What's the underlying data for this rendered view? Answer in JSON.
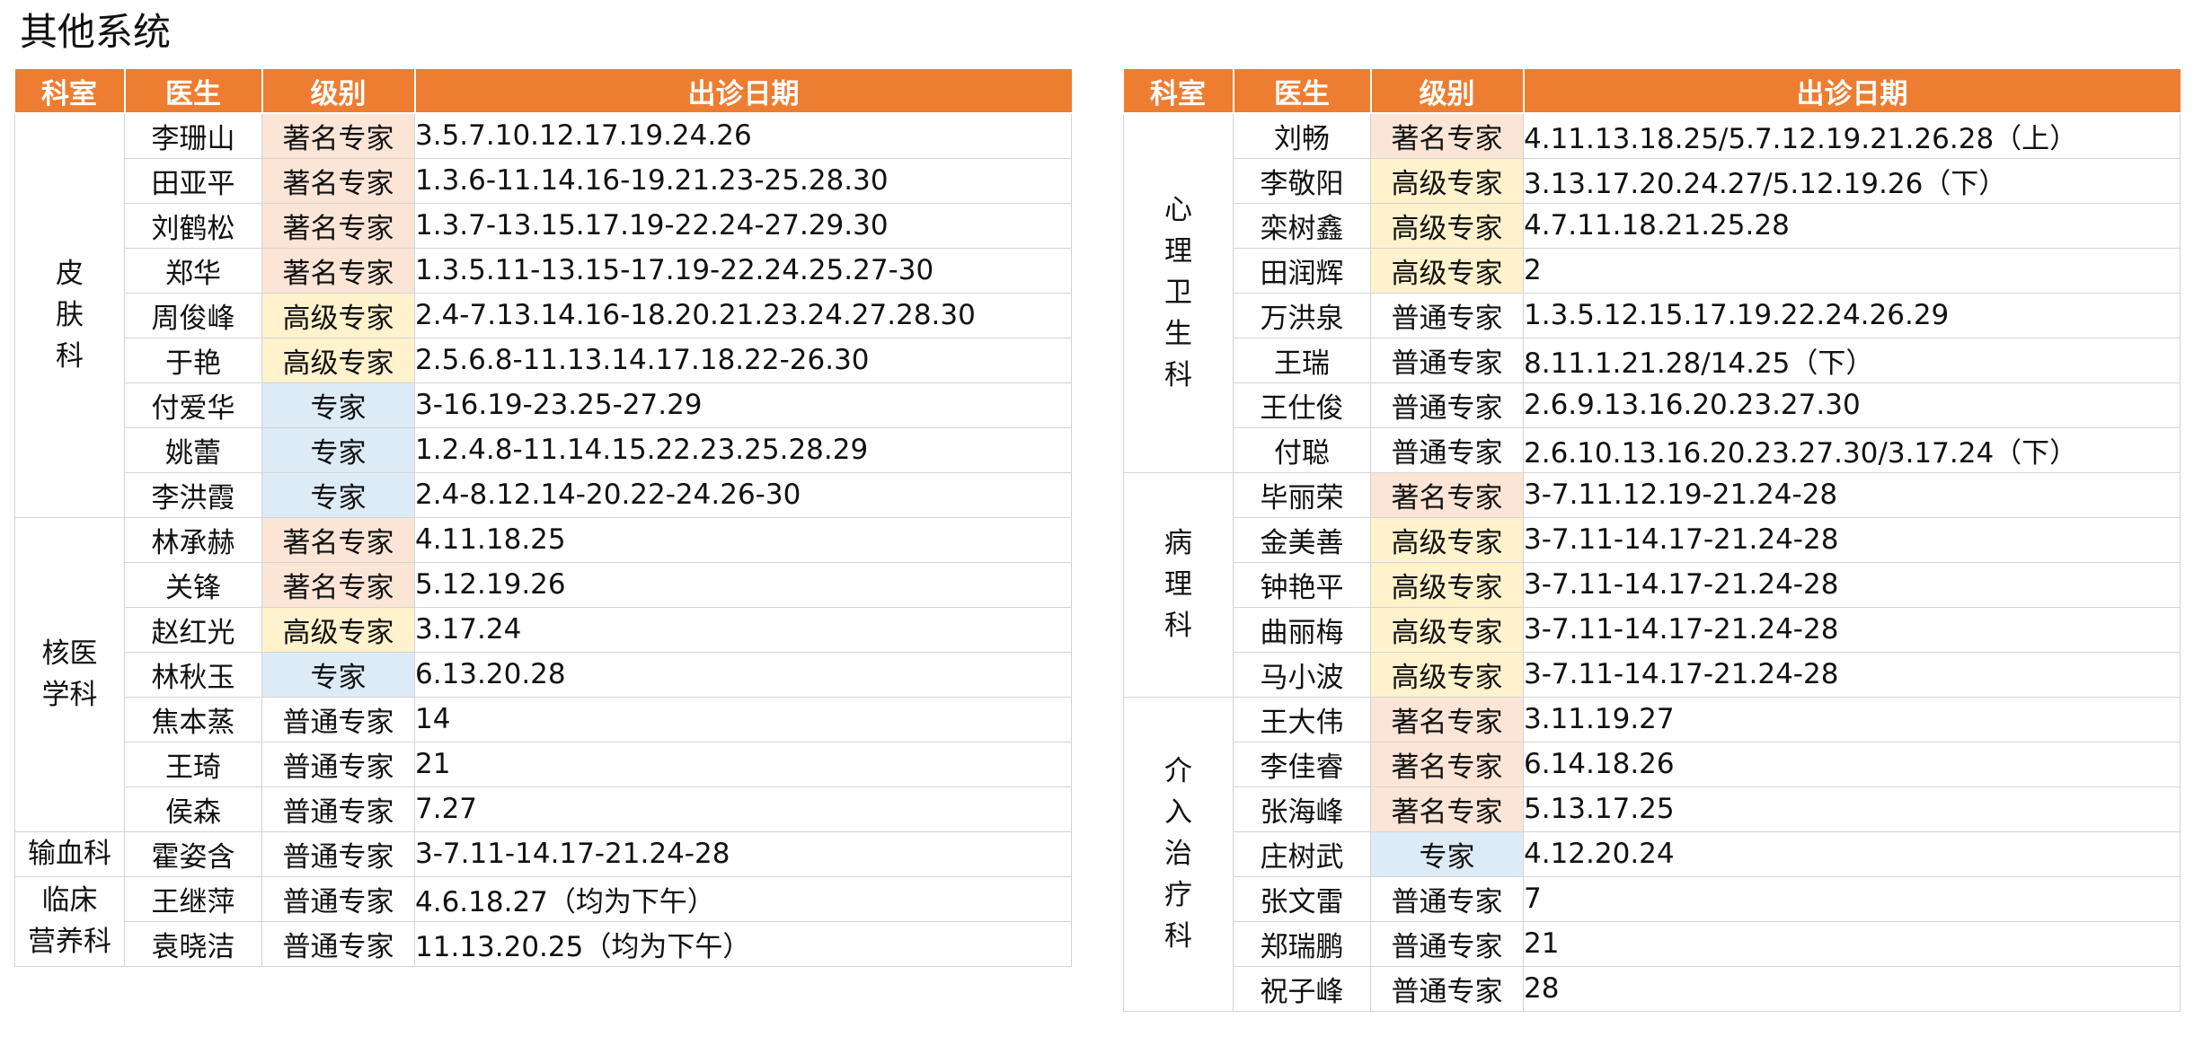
{
  "title": "其他系统",
  "headers": {
    "dept": "科室",
    "doctor": "医生",
    "level": "级别",
    "dates": "出诊日期"
  },
  "colors": {
    "header_bg": "#ed7d31",
    "famous_expert_bg": "#fbe5d6",
    "senior_expert_bg": "#fff2cc",
    "expert_bg": "#ddebf7"
  },
  "left_table": [
    {
      "dept": "皮\n肤\n科",
      "rows": [
        {
          "doctor": "李珊山",
          "level": "著名专家",
          "dates": "3.5.7.10.12.17.19.24.26"
        },
        {
          "doctor": "田亚平",
          "level": "著名专家",
          "dates": "1.3.6-11.14.16-19.21.23-25.28.30"
        },
        {
          "doctor": "刘鹤松",
          "level": "著名专家",
          "dates": "1.3.7-13.15.17.19-22.24-27.29.30"
        },
        {
          "doctor": "郑华",
          "level": "著名专家",
          "dates": "1.3.5.11-13.15-17.19-22.24.25.27-30"
        },
        {
          "doctor": "周俊峰",
          "level": "高级专家",
          "dates": "2.4-7.13.14.16-18.20.21.23.24.27.28.30"
        },
        {
          "doctor": "于艳",
          "level": "高级专家",
          "dates": "2.5.6.8-11.13.14.17.18.22-26.30"
        },
        {
          "doctor": "付爱华",
          "level": "专家",
          "dates": "3-16.19-23.25-27.29"
        },
        {
          "doctor": "姚蕾",
          "level": "专家",
          "dates": "1.2.4.8-11.14.15.22.23.25.28.29"
        },
        {
          "doctor": "李洪霞",
          "level": "专家",
          "dates": "2.4-8.12.14-20.22-24.26-30"
        }
      ]
    },
    {
      "dept": "核医\n学科",
      "rows": [
        {
          "doctor": "林承赫",
          "level": "著名专家",
          "dates": "4.11.18.25"
        },
        {
          "doctor": "关锋",
          "level": "著名专家",
          "dates": "5.12.19.26"
        },
        {
          "doctor": "赵红光",
          "level": "高级专家",
          "dates": "3.17.24"
        },
        {
          "doctor": "林秋玉",
          "level": "专家",
          "dates": "6.13.20.28"
        },
        {
          "doctor": "焦本蒸",
          "level": "普通专家",
          "dates": "14"
        },
        {
          "doctor": "王琦",
          "level": "普通专家",
          "dates": "21"
        },
        {
          "doctor": "侯森",
          "level": "普通专家",
          "dates": "7.27"
        }
      ]
    },
    {
      "dept": "输血科",
      "rows": [
        {
          "doctor": "霍姿含",
          "level": "普通专家",
          "dates": "3-7.11-14.17-21.24-28"
        }
      ]
    },
    {
      "dept": "临床\n营养科",
      "rows": [
        {
          "doctor": "王继萍",
          "level": "普通专家",
          "dates": "4.6.18.27（均为下午）"
        },
        {
          "doctor": "袁晓洁",
          "level": "普通专家",
          "dates": "11.13.20.25（均为下午）"
        }
      ]
    }
  ],
  "right_table": [
    {
      "dept": "心\n理\n卫\n生\n科",
      "rows": [
        {
          "doctor": "刘畅",
          "level": "著名专家",
          "dates": "4.11.13.18.25/5.7.12.19.21.26.28（上）"
        },
        {
          "doctor": "李敬阳",
          "level": "高级专家",
          "dates": "3.13.17.20.24.27/5.12.19.26（下）"
        },
        {
          "doctor": "栾树鑫",
          "level": "高级专家",
          "dates": "4.7.11.18.21.25.28"
        },
        {
          "doctor": "田润辉",
          "level": "高级专家",
          "dates": "2"
        },
        {
          "doctor": "万洪泉",
          "level": "普通专家",
          "dates": "1.3.5.12.15.17.19.22.24.26.29"
        },
        {
          "doctor": "王瑞",
          "level": "普通专家",
          "dates": "8.11.1.21.28/14.25（下）"
        },
        {
          "doctor": "王仕俊",
          "level": "普通专家",
          "dates": "2.6.9.13.16.20.23.27.30"
        },
        {
          "doctor": "付聪",
          "level": "普通专家",
          "dates": "2.6.10.13.16.20.23.27.30/3.17.24（下）"
        }
      ]
    },
    {
      "dept": "病\n理\n科",
      "rows": [
        {
          "doctor": "毕丽荣",
          "level": "著名专家",
          "dates": "3-7.11.12.19-21.24-28"
        },
        {
          "doctor": "金美善",
          "level": "高级专家",
          "dates": "3-7.11-14.17-21.24-28"
        },
        {
          "doctor": "钟艳平",
          "level": "高级专家",
          "dates": "3-7.11-14.17-21.24-28"
        },
        {
          "doctor": "曲丽梅",
          "level": "高级专家",
          "dates": "3-7.11-14.17-21.24-28"
        },
        {
          "doctor": "马小波",
          "level": "高级专家",
          "dates": "3-7.11-14.17-21.24-28"
        }
      ]
    },
    {
      "dept": "介\n入\n治\n疗\n科",
      "rows": [
        {
          "doctor": "王大伟",
          "level": "著名专家",
          "dates": "3.11.19.27"
        },
        {
          "doctor": "李佳睿",
          "level": "著名专家",
          "dates": "6.14.18.26"
        },
        {
          "doctor": "张海峰",
          "level": "著名专家",
          "dates": "5.13.17.25"
        },
        {
          "doctor": "庄树武",
          "level": "专家",
          "dates": "4.12.20.24"
        },
        {
          "doctor": "张文雷",
          "level": "普通专家",
          "dates": "7"
        },
        {
          "doctor": "郑瑞鹏",
          "level": "普通专家",
          "dates": "21"
        },
        {
          "doctor": "祝子峰",
          "level": "普通专家",
          "dates": "28"
        }
      ]
    }
  ]
}
